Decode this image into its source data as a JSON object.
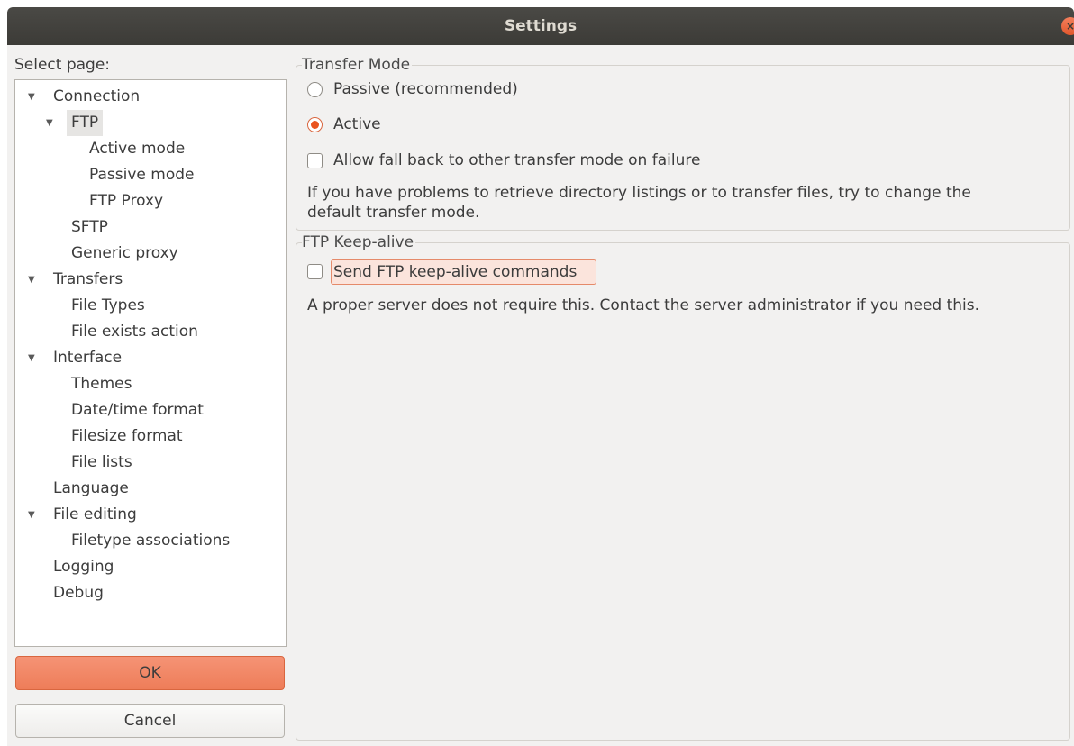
{
  "window": {
    "title": "Settings",
    "close_glyph": "×"
  },
  "sidebar": {
    "label": "Select page:",
    "tree": [
      {
        "label": "Connection",
        "level": 0,
        "expander": "▼"
      },
      {
        "label": "FTP",
        "level": 1,
        "expander": "▼",
        "selected": true
      },
      {
        "label": "Active mode",
        "level": 2
      },
      {
        "label": "Passive mode",
        "level": 2
      },
      {
        "label": "FTP Proxy",
        "level": 2
      },
      {
        "label": "SFTP",
        "level": 1
      },
      {
        "label": "Generic proxy",
        "level": 1
      },
      {
        "label": "Transfers",
        "level": 0,
        "expander": "▼"
      },
      {
        "label": "File Types",
        "level": 1
      },
      {
        "label": "File exists action",
        "level": 1
      },
      {
        "label": "Interface",
        "level": 0,
        "expander": "▼"
      },
      {
        "label": "Themes",
        "level": 1
      },
      {
        "label": "Date/time format",
        "level": 1
      },
      {
        "label": "Filesize format",
        "level": 1
      },
      {
        "label": "File lists",
        "level": 1
      },
      {
        "label": "Language",
        "level": 0
      },
      {
        "label": "File editing",
        "level": 0,
        "expander": "▼"
      },
      {
        "label": "Filetype associations",
        "level": 1
      },
      {
        "label": "Logging",
        "level": 0
      },
      {
        "label": "Debug",
        "level": 0
      }
    ],
    "ok_label": "OK",
    "cancel_label": "Cancel"
  },
  "transfer_mode": {
    "title": "Transfer Mode",
    "passive_label": "Passive (recommended)",
    "active_label": "Active",
    "selected": "active",
    "fallback_label": "Allow fall back to other transfer mode on failure",
    "fallback_checked": false,
    "info_line1": "If you have problems to retrieve directory listings or to transfer files, try to change the",
    "info_line2": "default transfer mode."
  },
  "keep_alive": {
    "title": "FTP Keep-alive",
    "send_label": "Send FTP keep-alive commands",
    "send_checked": false,
    "info": "A proper server does not require this. Contact the server administrator if you need this."
  },
  "colors": {
    "accent": "#e95420",
    "titlebar": "#3c3b37",
    "ok_button": "#ee7d59"
  }
}
